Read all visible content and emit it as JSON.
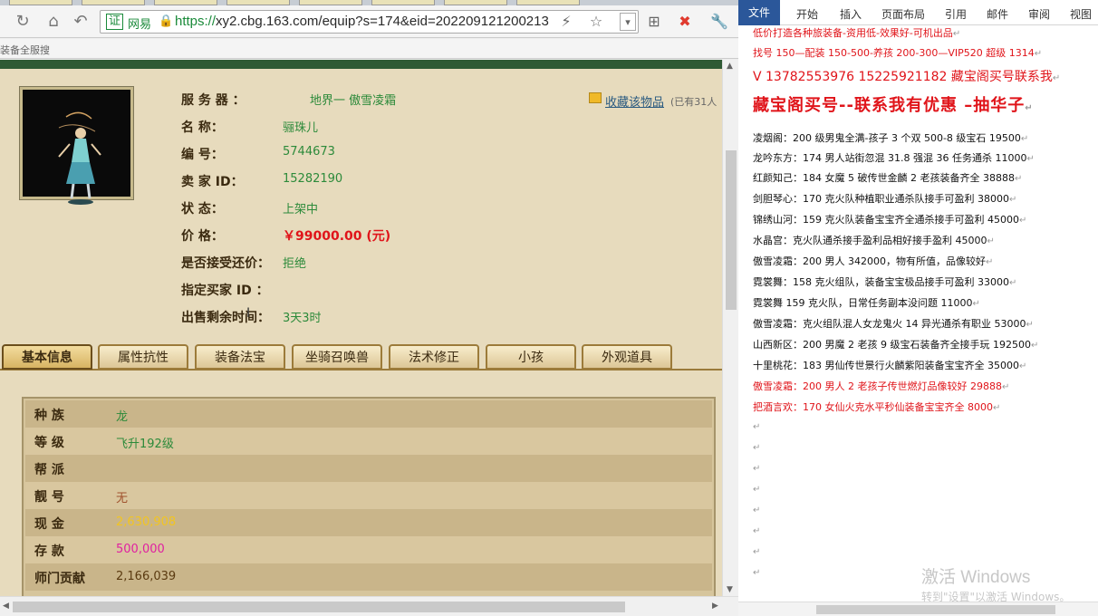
{
  "browser": {
    "url_scheme": "https://",
    "url_rest": "xy2.cbg.163.com/equip?s=174&eid=202209121200213",
    "site_name": "网易",
    "cert_label": "证",
    "bookmark": "装备全服搜"
  },
  "item": {
    "fields": [
      {
        "label": "服    务    器  ：",
        "value": "地界一  傲雪凌霜"
      },
      {
        "label": "名          称：",
        "value": "骊珠儿"
      },
      {
        "label": "编          号：",
        "value": "5744673"
      },
      {
        "label": "卖    家    ID：",
        "value": "15282190"
      },
      {
        "label": "状          态：",
        "value": "上架中"
      },
      {
        "label": "价          格：",
        "value": "￥99000.00 (元)"
      },
      {
        "label": "是否接受还价：",
        "value": "拒绝"
      },
      {
        "label": "指定买家 ID  ：",
        "value": ""
      },
      {
        "label": "出售剩余时间：",
        "value": "3天3时"
      }
    ],
    "favorite_label": "收藏该物品",
    "favorite_count": "(已有31人"
  },
  "tabs": [
    "基本信息",
    "属性抗性",
    "装备法宝",
    "坐骑召唤兽",
    "法术修正",
    "小孩",
    "外观道具"
  ],
  "stats": [
    {
      "label": "种    族",
      "value": "龙",
      "color": "#2c8a3a"
    },
    {
      "label": "等    级",
      "value": "飞升192级",
      "color": "#2c8a3a"
    },
    {
      "label": "帮    派",
      "value": "",
      "color": "#2c8a3a"
    },
    {
      "label": "靓    号",
      "value": "无",
      "color": "#a0522d"
    },
    {
      "label": "现    金",
      "value": "2,630,908",
      "color": "#f2c521"
    },
    {
      "label": "存    款",
      "value": "500,000",
      "color": "#e020a0"
    },
    {
      "label": "师门贡献",
      "value": "2,166,039",
      "color": "#5a3a10"
    }
  ],
  "word": {
    "ribbon": [
      "文件",
      "开始",
      "插入",
      "页面布局",
      "引用",
      "邮件",
      "审阅",
      "视图"
    ],
    "lines": [
      {
        "text": "低价打造各种旅装备-资用低-效果好-可机出品",
        "style": "red"
      },
      {
        "text": "找号 150—配装 150-500-养孩 200-300—VIP520 超级 1314",
        "style": "red"
      },
      {
        "text": "V 13782553976    15225921182   藏宝阁买号联系我",
        "style": "red big"
      },
      {
        "text": "藏宝阁买号--联系我有优惠 –抽华子",
        "style": "red huge"
      },
      {
        "text": "凌烟阁：200 级男鬼全满-孩子 3 个双 500-8 级宝石 19500",
        "style": ""
      },
      {
        "text": "龙吟东方：174 男人站街忽混 31.8 强混 36 任务通杀 11000",
        "style": ""
      },
      {
        "text": "红颜知己：184 女魔 5 破传世金麟 2 老孩装备齐全 38888",
        "style": ""
      },
      {
        "text": "剑胆琴心：170 克火队种植职业通杀队接手可盈利 38000",
        "style": ""
      },
      {
        "text": "锦绣山河：159 克火队装备宝宝齐全通杀接手可盈利 45000",
        "style": ""
      },
      {
        "text": "水晶宫：克火队通杀接手盈利品相好接手盈利 45000",
        "style": ""
      },
      {
        "text": "傲雪凌霜：200 男人 342000，物有所值，品像较好",
        "style": ""
      },
      {
        "text": "霓裳舞：158 克火组队，装备宝宝极品接手可盈利 33000",
        "style": ""
      },
      {
        "text": "霓裳舞 159 克火队，日常任务副本没问题 11000",
        "style": ""
      },
      {
        "text": "傲雪凌霜：克火组队混人女龙鬼火 14 异光通杀有职业 53000",
        "style": ""
      },
      {
        "text": "山西新区：200 男魔 2 老孩 9 级宝石装备齐全接手玩 192500",
        "style": ""
      },
      {
        "text": "十里桃花：183 男仙传世景行火麟紫阳装备宝宝齐全 35000",
        "style": ""
      },
      {
        "text": "傲雪凌霜：200 男人 2 老孩子传世燃灯品像较好 29888",
        "style": "red"
      },
      {
        "text": "把酒言欢：170 女仙火克水平秒仙装备宝宝齐全 8000",
        "style": "red"
      }
    ],
    "watermark_title": "激活 Windows",
    "watermark_sub": "转到\"设置\"以激活 Windows。"
  }
}
